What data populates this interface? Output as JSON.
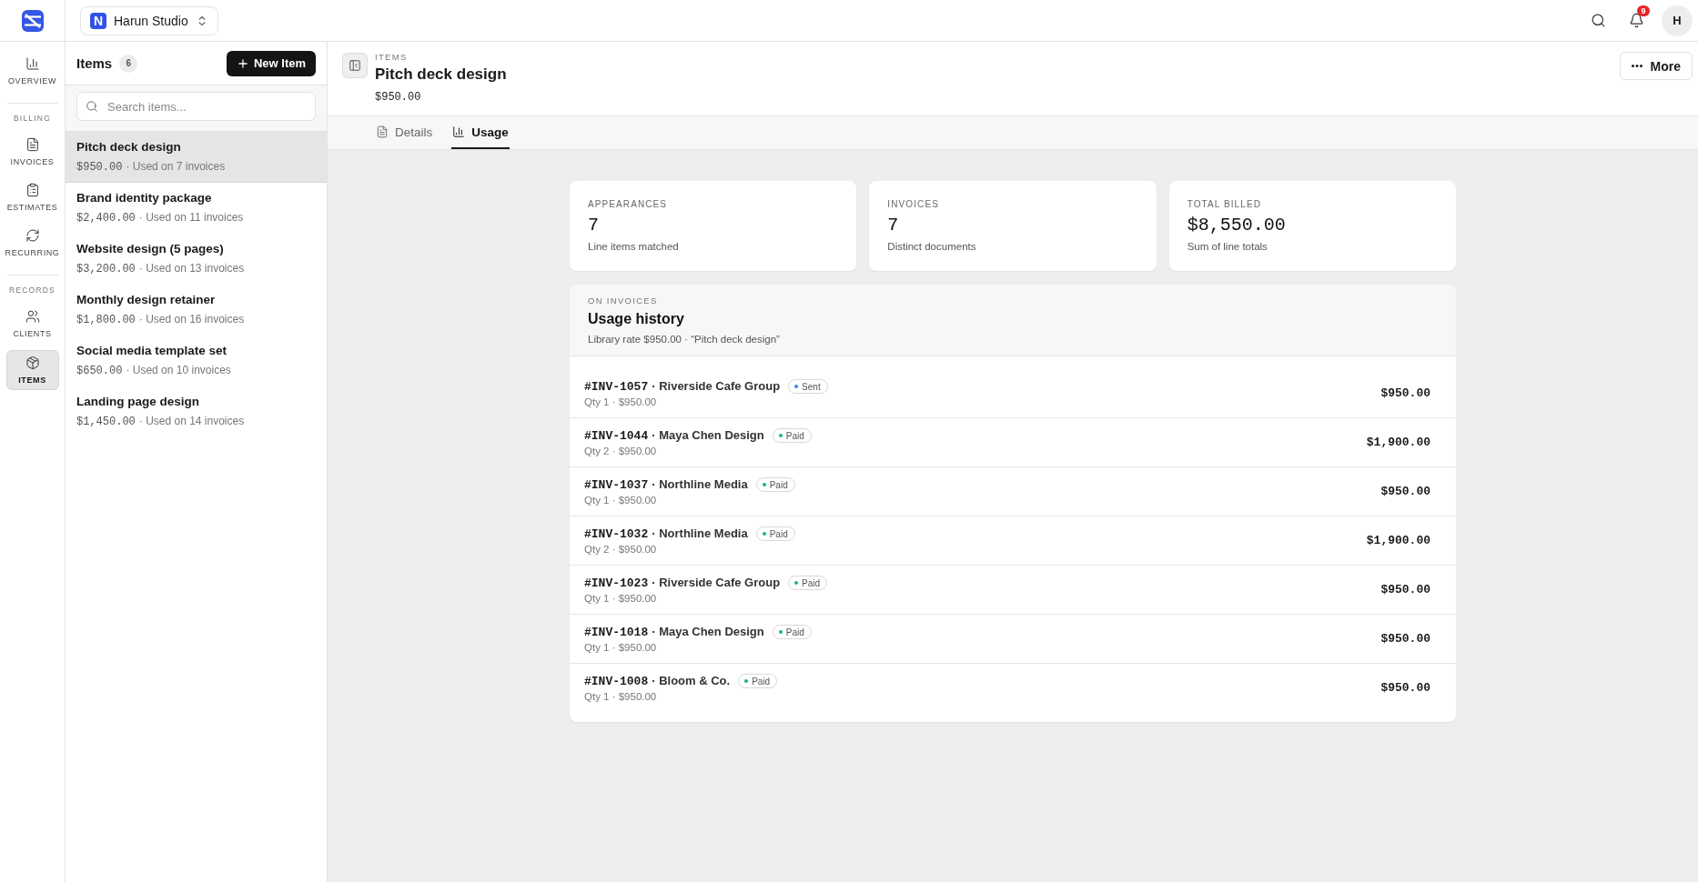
{
  "topbar": {
    "workspace": {
      "logo_letter": "N",
      "name": "Harun Studio"
    },
    "notifications": "9",
    "avatar": "H"
  },
  "nav": [
    {
      "kind": "link",
      "label": "OVERVIEW",
      "selected": false
    },
    {
      "kind": "section",
      "label": "BILLING"
    },
    {
      "kind": "link",
      "label": "INVOICES",
      "selected": false
    },
    {
      "kind": "link",
      "label": "ESTIMATES",
      "selected": false
    },
    {
      "kind": "link",
      "label": "RECURRING",
      "selected": false
    },
    {
      "kind": "section",
      "label": "RECORDS"
    },
    {
      "kind": "link",
      "label": "CLIENTS",
      "selected": false
    },
    {
      "kind": "link",
      "label": "ITEMS",
      "selected": true
    }
  ],
  "items_panel": {
    "title": "Items",
    "count": "6",
    "new_button": "New Item",
    "search": {
      "placeholder": "Search items..."
    },
    "items": [
      {
        "name": "Pitch deck design",
        "price": "$950.00",
        "usage": "· Used on 7 invoices",
        "selected": true
      },
      {
        "name": "Brand identity package",
        "price": "$2,400.00",
        "usage": "· Used on 11 invoices",
        "selected": false
      },
      {
        "name": "Website design (5 pages)",
        "price": "$3,200.00",
        "usage": "· Used on 13 invoices",
        "selected": false
      },
      {
        "name": "Monthly design retainer",
        "price": "$1,800.00",
        "usage": "· Used on 16 invoices",
        "selected": false
      },
      {
        "name": "Social media template set",
        "price": "$650.00",
        "usage": "· Used on 10 invoices",
        "selected": false
      },
      {
        "name": "Landing page design",
        "price": "$1,450.00",
        "usage": "· Used on 14 invoices",
        "selected": false
      }
    ]
  },
  "header": {
    "eyebrow": "ITEMS",
    "title": "Pitch deck design",
    "price": "$950.00",
    "more_button": "More"
  },
  "tabs": [
    {
      "label": "Details",
      "selected": false
    },
    {
      "label": "Usage",
      "selected": true
    }
  ],
  "stats": [
    {
      "label": "APPEARANCES",
      "value": "7",
      "caption": "Line items matched"
    },
    {
      "label": "INVOICES",
      "value": "7",
      "caption": "Distinct documents"
    },
    {
      "label": "TOTAL BILLED",
      "value": "$8,550.00",
      "caption": "Sum of line totals"
    }
  ],
  "usage": {
    "eyebrow": "ON INVOICES",
    "title": "Usage history",
    "subtitle": "Library rate $950.00 · “Pitch deck design”",
    "rows": [
      {
        "number": "#INV-1057",
        "client": "· Riverside Cafe Group",
        "status": {
          "label": "Sent",
          "color": "#3b82f6"
        },
        "detail": "Qty 1 · $950.00",
        "amount": "$950.00"
      },
      {
        "number": "#INV-1044",
        "client": "· Maya Chen Design",
        "status": {
          "label": "Paid",
          "color": "#10b981"
        },
        "detail": "Qty 2 · $950.00",
        "amount": "$1,900.00"
      },
      {
        "number": "#INV-1037",
        "client": "· Northline Media",
        "status": {
          "label": "Paid",
          "color": "#10b981"
        },
        "detail": "Qty 1 · $950.00",
        "amount": "$950.00"
      },
      {
        "number": "#INV-1032",
        "client": "· Northline Media",
        "status": {
          "label": "Paid",
          "color": "#10b981"
        },
        "detail": "Qty 2 · $950.00",
        "amount": "$1,900.00"
      },
      {
        "number": "#INV-1023",
        "client": "· Riverside Cafe Group",
        "status": {
          "label": "Paid",
          "color": "#10b981"
        },
        "detail": "Qty 1 · $950.00",
        "amount": "$950.00"
      },
      {
        "number": "#INV-1018",
        "client": "· Maya Chen Design",
        "status": {
          "label": "Paid",
          "color": "#10b981"
        },
        "detail": "Qty 1 · $950.00",
        "amount": "$950.00"
      },
      {
        "number": "#INV-1008",
        "client": "· Bloom & Co.",
        "status": {
          "label": "Paid",
          "color": "#10b981"
        },
        "detail": "Qty 1 · $950.00",
        "amount": "$950.00"
      }
    ]
  }
}
